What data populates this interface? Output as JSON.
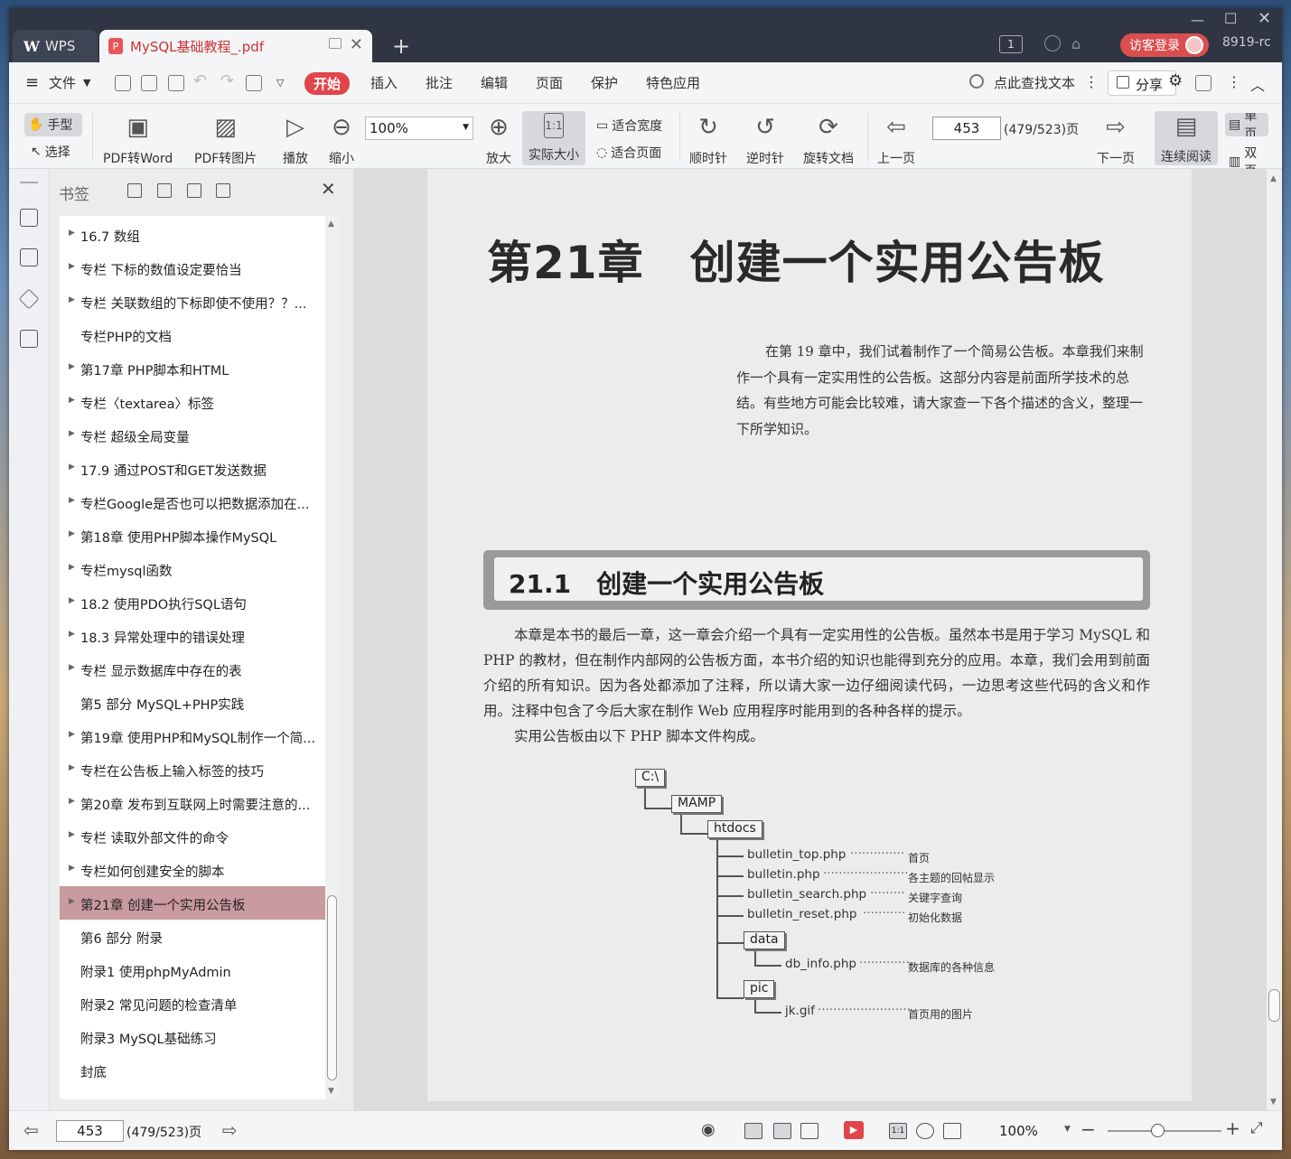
{
  "titlebar": {
    "app_tab": "WPS",
    "doc_tab": "MySQL基础教程_.pdf",
    "page_badge": "1",
    "login_label": "访客登录",
    "user_id": "8919-rc"
  },
  "menu": {
    "file": "文件",
    "items": [
      "开始",
      "插入",
      "批注",
      "编辑",
      "页面",
      "保护",
      "特色应用"
    ],
    "search_label": "点此查找文本",
    "share_label": "分享"
  },
  "toolbar": {
    "hand": "手型",
    "select": "选择",
    "pdf_to_word": "PDF转Word",
    "pdf_to_image": "PDF转图片",
    "play": "播放",
    "zoom_out": "缩小",
    "zoom_value": "100%",
    "zoom_in": "放大",
    "actual_size": "实际大小",
    "fit_width": "适合宽度",
    "fit_page": "适合页面",
    "rotate_cw": "顺时针",
    "rotate_ccw": "逆时针",
    "rotate_doc": "旋转文档",
    "prev_page": "上一页",
    "page_value": "453",
    "page_total": "(479/523)页",
    "next_page": "下一页",
    "continuous": "连续阅读",
    "single": "单页",
    "double": "双页"
  },
  "bookmarks": {
    "title": "书签",
    "items": [
      {
        "label": "16.7 数组",
        "arrow": true
      },
      {
        "label": "专栏 下标的数值设定要恰当",
        "arrow": true
      },
      {
        "label": "专栏 关联数组的下标即使不使用？？...",
        "arrow": true
      },
      {
        "label": "专栏PHP的文档",
        "arrow": false
      },
      {
        "label": "第17章 PHP脚本和HTML",
        "arrow": true
      },
      {
        "label": "专栏〈textarea〉标签",
        "arrow": true
      },
      {
        "label": "专栏 超级全局变量",
        "arrow": true
      },
      {
        "label": "17.9 通过POST和GET发送数据",
        "arrow": true
      },
      {
        "label": "专栏Google是否也可以把数据添加在...",
        "arrow": true
      },
      {
        "label": "第18章 使用PHP脚本操作MySQL",
        "arrow": true
      },
      {
        "label": "专栏mysql函数",
        "arrow": true
      },
      {
        "label": "18.2 使用PDO执行SQL语句",
        "arrow": true
      },
      {
        "label": "18.3 异常处理中的错误处理",
        "arrow": true
      },
      {
        "label": "专栏 显示数据库中存在的表",
        "arrow": true
      },
      {
        "label": "第5 部分 MySQL+PHP实践",
        "arrow": false
      },
      {
        "label": "第19章 使用PHP和MySQL制作一个简...",
        "arrow": true
      },
      {
        "label": "专栏在公告板上输入标签的技巧",
        "arrow": true
      },
      {
        "label": "第20章 发布到互联网上时需要注意的...",
        "arrow": true
      },
      {
        "label": "专栏 读取外部文件的命令",
        "arrow": true
      },
      {
        "label": "专栏如何创建安全的脚本",
        "arrow": true
      },
      {
        "label": "第21章 创建一个实用公告板",
        "arrow": true,
        "selected": true
      },
      {
        "label": "第6 部分 附录",
        "arrow": false
      },
      {
        "label": "附录1 使用phpMyAdmin",
        "arrow": false
      },
      {
        "label": "附录2 常见问题的检查清单",
        "arrow": false
      },
      {
        "label": "附录3 MySQL基础练习",
        "arrow": false
      },
      {
        "label": "封底",
        "arrow": false
      }
    ]
  },
  "page": {
    "chapter_title": "第21章　创建一个实用公告板",
    "intro": "在第 19 章中，我们试着制作了一个简易公告板。本章我们来制作一个具有一定实用性的公告板。这部分内容是前面所学技术的总结。有些地方可能会比较难，请大家查一下各个描述的含义，整理一下所学知识。",
    "section_title": "21.1　创建一个实用公告板",
    "body1": "本章是本书的最后一章，这一章会介绍一个具有一定实用性的公告板。虽然本书是用于学习 MySQL 和 PHP 的教材，但在制作内部网的公告板方面，本书介绍的知识也能得到充分的应用。本章，我们会用到前面介绍的所有知识。因为各处都添加了注释，所以请大家一边仔细阅读代码，一边思考这些代码的含义和作用。注释中包含了今后大家在制作 Web 应用程序时能用到的各种各样的提示。",
    "body2": "实用公告板由以下 PHP 脚本文件构成。",
    "tree": {
      "root": "C:\\",
      "mamp": "MAMP",
      "htdocs": "htdocs",
      "files": [
        {
          "name": "bulletin_top.php",
          "desc": "首页"
        },
        {
          "name": "bulletin.php",
          "desc": "各主题的回帖显示"
        },
        {
          "name": "bulletin_search.php",
          "desc": "关键字查询"
        },
        {
          "name": "bulletin_reset.php",
          "desc": "初始化数据"
        }
      ],
      "data": "data",
      "data_file": {
        "name": "db_info.php",
        "desc": "数据库的各种信息"
      },
      "pic": "pic",
      "pic_file": {
        "name": "jk.gif",
        "desc": "首页用的图片"
      }
    }
  },
  "status": {
    "page_value": "453",
    "page_total": "(479/523)页",
    "zoom": "100%"
  }
}
